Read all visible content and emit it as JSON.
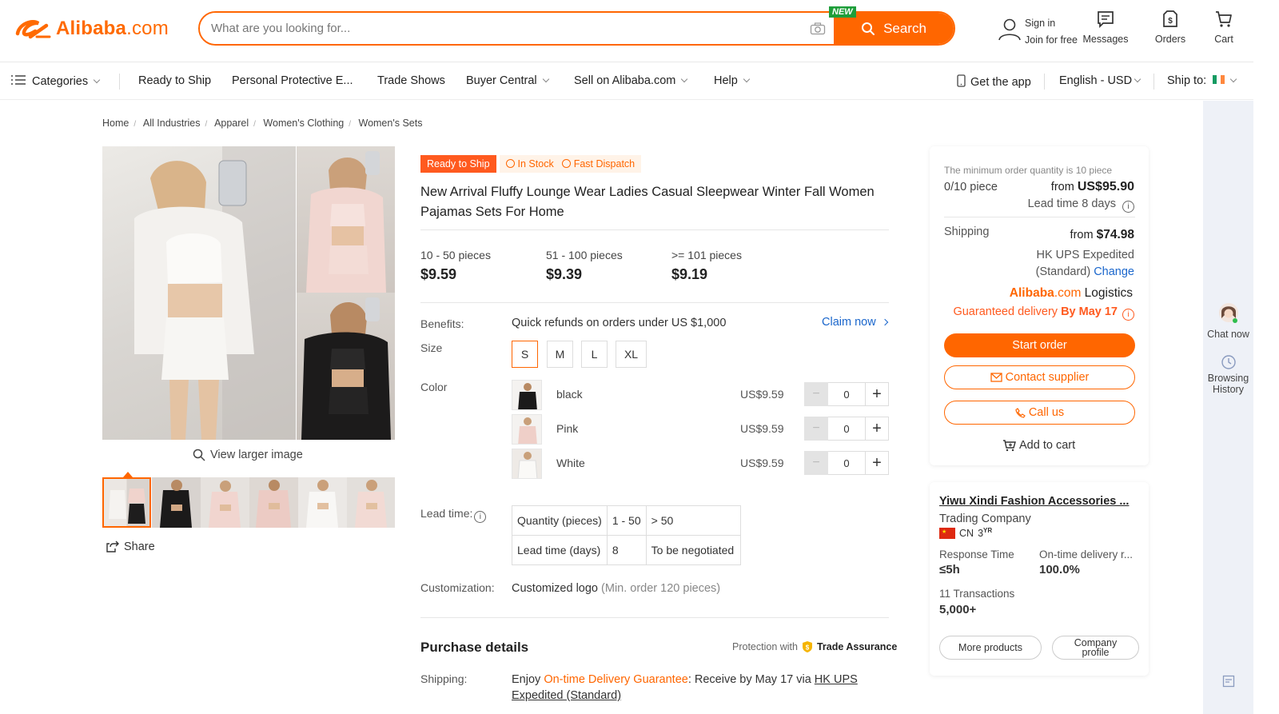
{
  "header": {
    "logo_text": "Alibaba",
    "logo_suffix": ".com",
    "search_placeholder": "What are you looking for...",
    "new_badge": "NEW",
    "search_button": "Search",
    "signin": "Sign in",
    "join": "Join for free",
    "messages": "Messages",
    "orders": "Orders",
    "cart": "Cart"
  },
  "nav": {
    "categories": "Categories",
    "ready_to_ship": "Ready to Ship",
    "ppe": "Personal Protective E...",
    "trade_shows": "Trade Shows",
    "buyer_central": "Buyer Central",
    "sell": "Sell on Alibaba.com",
    "help": "Help",
    "get_app": "Get the app",
    "language": "English - USD",
    "ship_to": "Ship to:"
  },
  "breadcrumb": [
    "Home",
    "All Industries",
    "Apparel",
    "Women's Clothing",
    "Women's Sets"
  ],
  "gallery": {
    "view_larger": "View larger image",
    "share": "Share"
  },
  "product": {
    "tag_ready": "Ready to Ship",
    "tag_stock": "In Stock",
    "tag_dispatch": "Fast Dispatch",
    "title": "New Arrival Fluffy Lounge Wear Ladies Casual Sleepwear Winter Fall Women Pajamas Sets For Home",
    "tiers": [
      {
        "range": "10 - 50 pieces",
        "price": "$9.59"
      },
      {
        "range": "51 - 100 pieces",
        "price": "$9.39"
      },
      {
        "range": ">= 101 pieces",
        "price": "$9.19"
      }
    ],
    "benefits_label": "Benefits:",
    "benefits_text": "Quick refunds on orders under US $1,000",
    "claim_now": "Claim now",
    "size_label": "Size",
    "sizes": [
      "S",
      "M",
      "L",
      "XL"
    ],
    "color_label": "Color",
    "colors": [
      {
        "name": "black",
        "price": "US$9.59",
        "qty": "0"
      },
      {
        "name": "Pink",
        "price": "US$9.59",
        "qty": "0"
      },
      {
        "name": "White",
        "price": "US$9.59",
        "qty": "0"
      }
    ],
    "lead_label": "Lead time:",
    "lead_table": {
      "row1": [
        "Quantity (pieces)",
        "1 - 50",
        "> 50"
      ],
      "row2": [
        "Lead time (days)",
        "8",
        "To be negotiated"
      ]
    },
    "custom_label": "Customization:",
    "custom_text": "Customized logo",
    "custom_note": "(Min. order 120 pieces)",
    "purchase_details": "Purchase details",
    "protection": "Protection with",
    "trade_assurance": "Trade Assurance",
    "shipping_label": "Shipping:",
    "shipping_enjoy": "Enjoy ",
    "shipping_guarantee": "On-time Delivery Guarantee",
    "shipping_receive": ": Receive by May 17 via ",
    "shipping_method": "HK UPS Expedited (Standard)"
  },
  "order": {
    "min_note": "The minimum order quantity is 10 piece",
    "pieces": "0/10 piece",
    "from": "from ",
    "price": "US$95.90",
    "lead_time": "Lead time 8 days",
    "shipping_label": "Shipping",
    "shipping_from": "from ",
    "shipping_price": "$74.98",
    "shipping_method1": "HK UPS Expedited",
    "shipping_method2": "(Standard)",
    "change": "Change",
    "logistics_brand": "Alibaba",
    "logistics_com": ".com",
    "logistics": " Logistics",
    "guaranteed": "Guaranteed delivery ",
    "by_date": "By May 17",
    "start_order": "Start order",
    "contact_supplier": "Contact supplier",
    "call_us": "Call us",
    "add_to_cart": "Add to cart"
  },
  "supplier": {
    "name": "Yiwu Xindi Fashion Accessories ...",
    "type": "Trading Company",
    "country": "CN",
    "years": "3",
    "years_unit": "YR",
    "response_label": "Response Time",
    "response_value": "≤5h",
    "ontime_label": "On-time delivery r...",
    "ontime_value": "100.0%",
    "transactions_label": "11 Transactions",
    "transactions_value": "5,000+",
    "more_products": "More products",
    "company_profile_1": "Company",
    "company_profile_2": "profile"
  },
  "rail": {
    "chat_now": "Chat now",
    "browsing_1": "Browsing",
    "browsing_2": "History"
  },
  "colors": {
    "brand_orange": "#ff6600",
    "link_blue": "#1a66cc",
    "rail_bg": "#eef1f7"
  }
}
